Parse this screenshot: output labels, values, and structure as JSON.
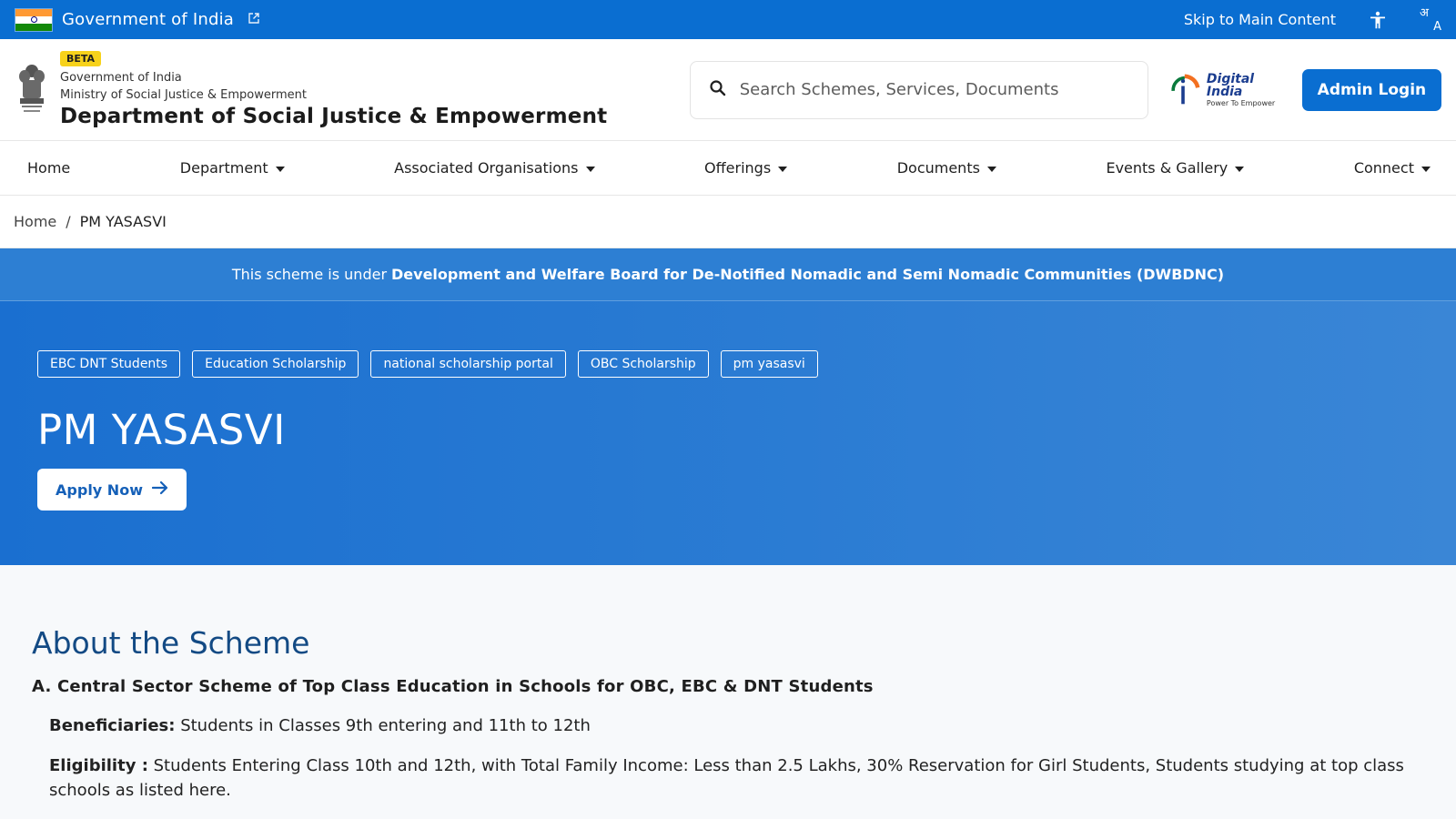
{
  "gov_bar": {
    "title": "Government of India",
    "skip_link": "Skip to Main Content",
    "icons": [
      "external-link-icon",
      "accessibility-icon",
      "language-icon"
    ],
    "lang_glyph_top": "अ",
    "lang_glyph_bottom": "A"
  },
  "header": {
    "beta": "BETA",
    "gov_line": "Government of India",
    "ministry_line": "Ministry of Social Justice & Empowerment",
    "department": "Department of Social Justice & Empowerment",
    "search_placeholder": "Search Schemes, Services, Documents",
    "digital_india_main": "Digital India",
    "digital_india_sub": "Power To Empower",
    "admin_login": "Admin Login"
  },
  "nav": {
    "items": [
      {
        "label": "Home",
        "dropdown": false
      },
      {
        "label": "Department",
        "dropdown": true
      },
      {
        "label": "Associated Organisations",
        "dropdown": true
      },
      {
        "label": "Offerings",
        "dropdown": true
      },
      {
        "label": "Documents",
        "dropdown": true
      },
      {
        "label": "Events & Gallery",
        "dropdown": true
      },
      {
        "label": "Connect",
        "dropdown": true
      }
    ]
  },
  "breadcrumb": {
    "home": "Home",
    "separator": "/",
    "current": "PM YASASVI"
  },
  "notice": {
    "prefix": "This scheme is under",
    "board": "Development and Welfare Board for De-Notified Nomadic and Semi Nomadic Communities (DWBDNC)"
  },
  "hero": {
    "tags": [
      "EBC DNT Students",
      "Education Scholarship",
      "national scholarship portal",
      "OBC Scholarship",
      "pm yasasvi"
    ],
    "title": "PM YASASVI",
    "apply_label": "Apply Now"
  },
  "content": {
    "about_title": "About the Scheme",
    "scheme_subtitle": "A. Central Sector Scheme of Top Class Education in Schools for OBC, EBC & DNT Students",
    "beneficiaries_label": "Beneficiaries:",
    "beneficiaries_text": "Students in Classes 9th entering and 11th to 12th",
    "eligibility_label": "Eligibility :",
    "eligibility_text": "Students Entering Class 10th and 12th, with Total Family Income: Less than 2.5 Lakhs, 30% Reservation for Girl Students, Students studying at top class schools as listed here."
  },
  "colors": {
    "primary_blue": "#0a6ed1",
    "hero_blue": "#2b7cd3",
    "heading_blue": "#134a84",
    "beta_yellow": "#f7d21b"
  }
}
